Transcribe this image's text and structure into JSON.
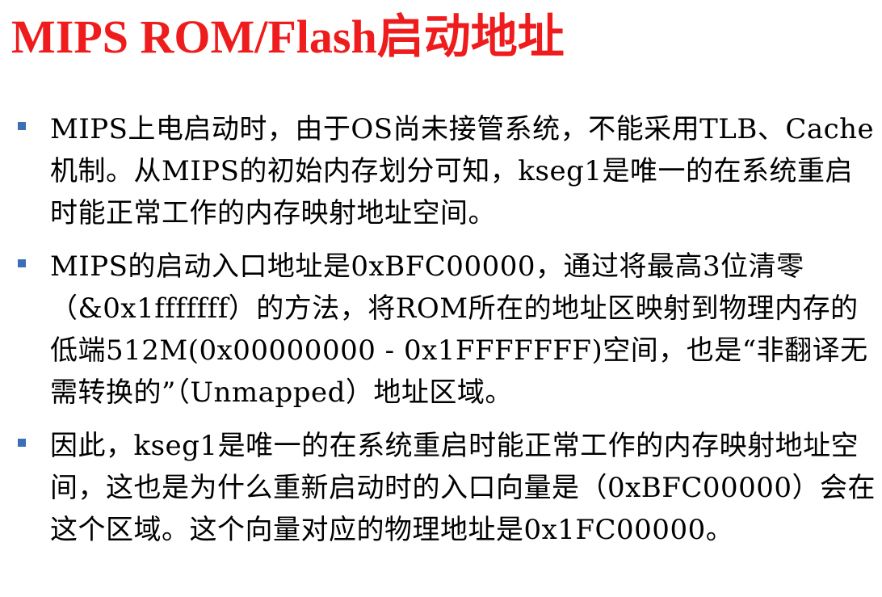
{
  "title": "MIPS ROM/Flash启动地址",
  "colors": {
    "title": "#ee1c1c",
    "bullet_marker": "#3b6fb6",
    "text": "#000000",
    "background": "#ffffff"
  },
  "bullets": [
    {
      "marker_icon": "square-bullet-icon",
      "text": "MIPS上电启动时，由于OS尚未接管系统，不能采用TLB、Cache机制。从MIPS的初始内存划分可知，kseg1是唯一的在系统重启时能正常工作的内存映射地址空间。"
    },
    {
      "marker_icon": "square-bullet-icon",
      "text": "MIPS的启动入口地址是0xBFC00000，通过将最高3位清零（&0x1fffffff）的方法，将ROM所在的地址区映射到物理内存的低端512M(0x00000000 - 0x1FFFFFFF)空间，也是“非翻译无需转换的”（Unmapped）地址区域。"
    },
    {
      "marker_icon": "square-bullet-icon",
      "text": "因此，kseg1是唯一的在系统重启时能正常工作的内存映射地址空间，这也是为什么重新启动时的入口向量是（0xBFC00000）会在这个区域。这个向量对应的物理地址是0x1FC00000。"
    }
  ]
}
